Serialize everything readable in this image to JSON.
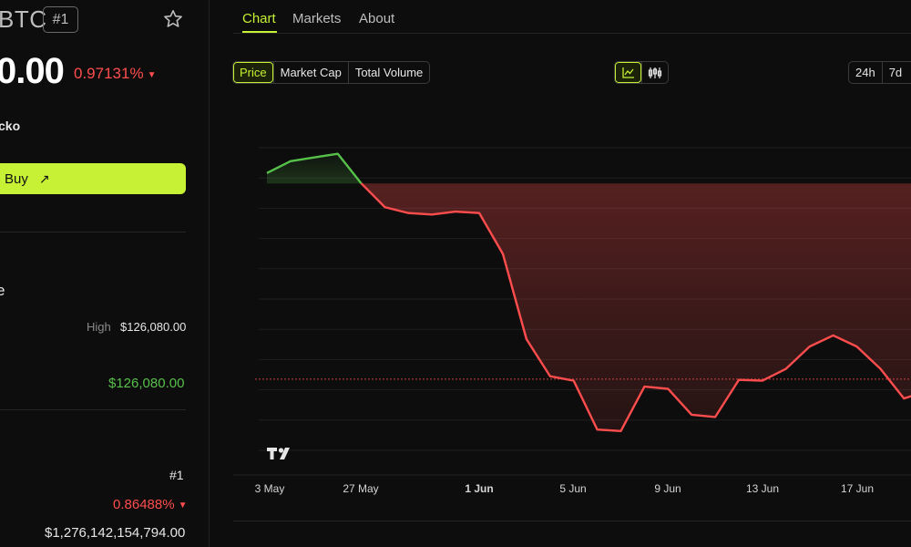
{
  "coin": {
    "symbol": "BTC",
    "rank_badge": "#1",
    "price": "0.00",
    "price_change": "0.97131%",
    "source": "cko",
    "buy_label": "Buy",
    "section_title": "e",
    "high_label": "High",
    "high_value": "$126,080.00",
    "green_value": "$126,080.00",
    "rank": "#1",
    "market_change": "0.86488%",
    "market_cap": "$1,276,142,154,794.00"
  },
  "tabs": [
    {
      "label": "Chart",
      "active": true
    },
    {
      "label": "Markets",
      "active": false
    },
    {
      "label": "About",
      "active": false
    }
  ],
  "metric_options": [
    {
      "label": "Price",
      "active": true
    },
    {
      "label": "Market Cap",
      "active": false
    },
    {
      "label": "Total Volume",
      "active": false
    }
  ],
  "chart_type_options": [
    {
      "icon": "line-chart-icon",
      "active": true
    },
    {
      "icon": "candlestick-icon",
      "active": false
    }
  ],
  "range_options": [
    {
      "label": "24h"
    },
    {
      "label": "7d"
    }
  ],
  "colors": {
    "accent": "#c6f135",
    "up": "#57c04a",
    "down": "#ff4d4d",
    "background": "#0d0d0d"
  },
  "chart_data": {
    "type": "line",
    "x_ticks": [
      "3 May",
      "27 May",
      "1 Jun",
      "5 Jun",
      "9 Jun",
      "13 Jun",
      "17 Jun"
    ],
    "bold_tick": "1 Jun",
    "values": [
      0.74,
      0.9,
      0.95,
      1.0,
      0.6,
      0.28,
      0.2,
      0.18,
      0.22,
      0.2,
      -0.35,
      -1.5,
      -2.0,
      -2.06,
      -2.72,
      -2.74,
      -2.14,
      -2.17,
      -2.52,
      -2.55,
      -2.05,
      -2.06,
      -1.9,
      -1.6,
      -1.45,
      -1.6,
      -1.9,
      -2.3,
      -2.2
    ],
    "split_index": 4,
    "baseline": -2.04,
    "ylim": [
      -3.0,
      1.5
    ],
    "grid": true
  }
}
